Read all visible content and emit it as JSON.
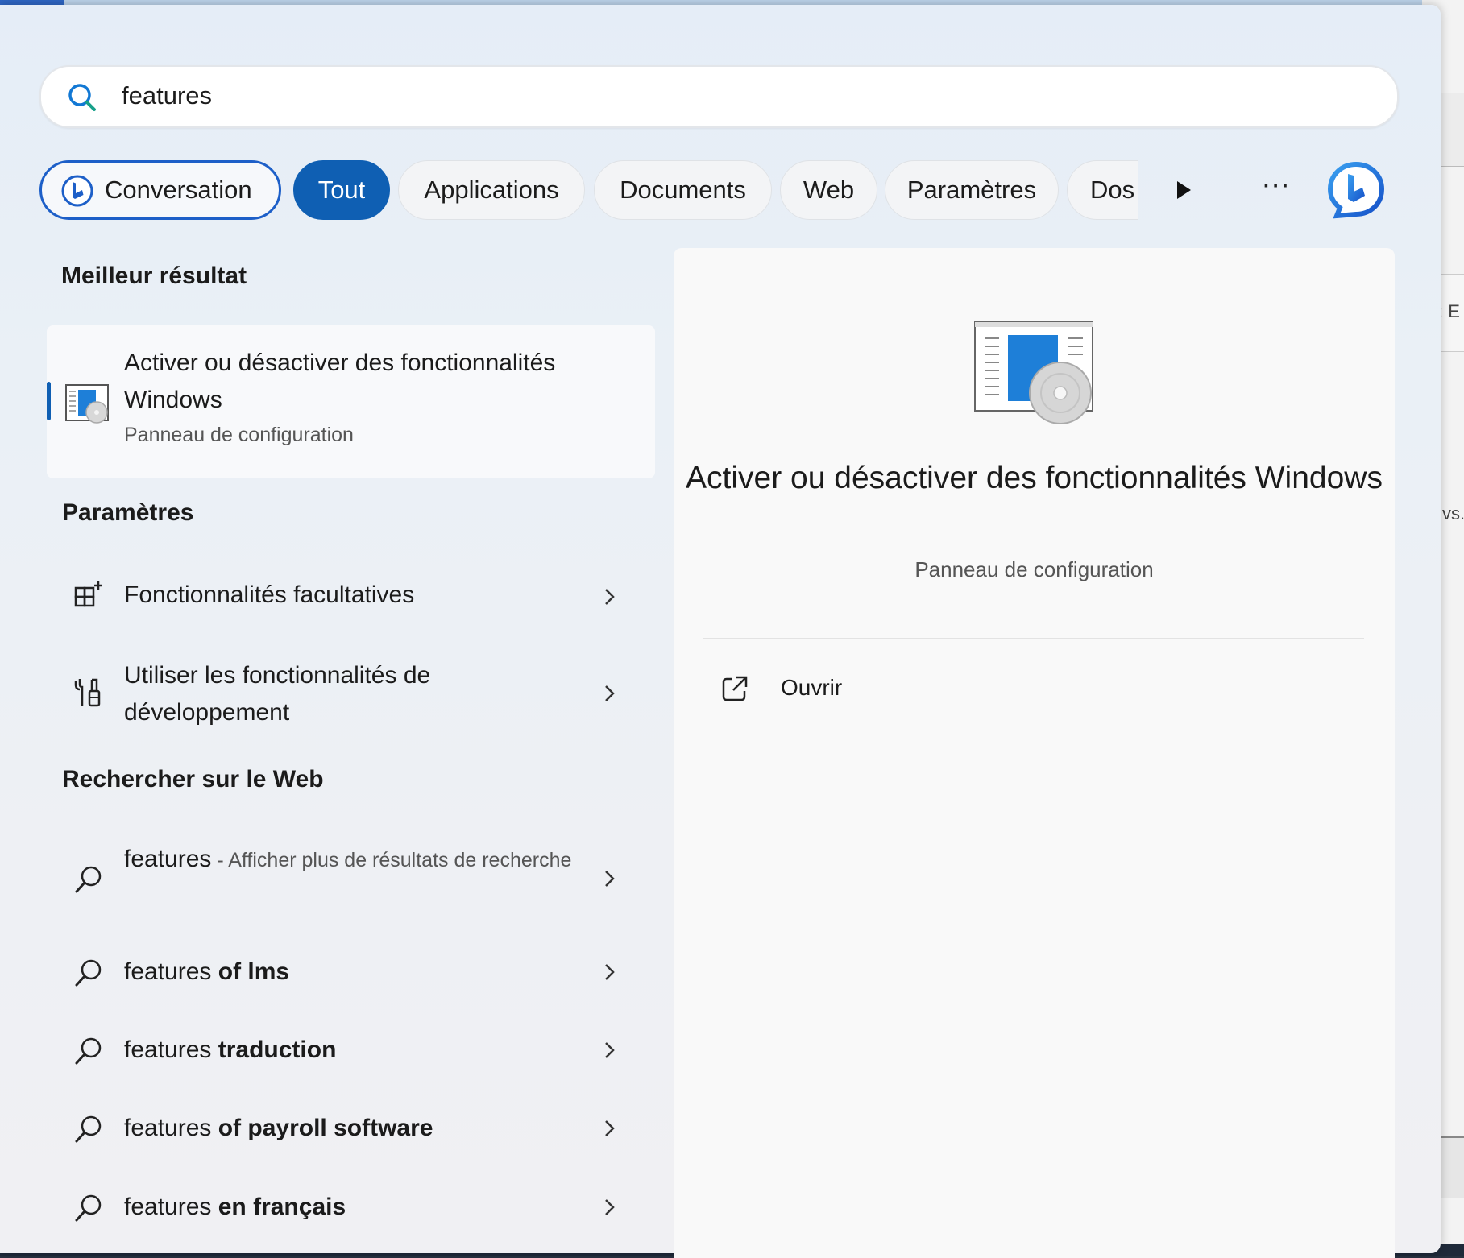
{
  "search": {
    "query": "features"
  },
  "filters": {
    "conversation": "Conversation",
    "all": "Tout",
    "apps": "Applications",
    "documents": "Documents",
    "web": "Web",
    "settings": "Paramètres",
    "folders": "Dos",
    "more": "···"
  },
  "best_match": {
    "heading": "Meilleur résultat",
    "title": "Activer ou désactiver des fonctionnalités Windows",
    "subtitle": "Panneau de configuration",
    "icon": "windows-features-icon"
  },
  "settings_section": {
    "heading": "Paramètres",
    "items": [
      {
        "label": "Fonctionnalités facultatives",
        "icon": "optional-features-icon"
      },
      {
        "label": "Utiliser les fonctionnalités de développement",
        "icon": "developer-tools-icon"
      }
    ]
  },
  "web_section": {
    "heading": "Rechercher sur le Web",
    "items": [
      {
        "prefix": "features",
        "suffix": " - Afficher plus de résultats de recherche"
      },
      {
        "prefix": "features",
        "suffix": " of lms"
      },
      {
        "prefix": "features",
        "suffix": " traduction"
      },
      {
        "prefix": "features",
        "suffix": " of payroll software"
      },
      {
        "prefix": "features",
        "suffix": " en français"
      }
    ]
  },
  "preview": {
    "title": "Activer ou désactiver des fonctionnalités Windows",
    "subtitle": "Panneau de configuration",
    "action_open": "Ouvrir"
  },
  "background": {
    "fragment1": ": E",
    "fragment2": "vs."
  },
  "colors": {
    "accent": "#0f5fb3",
    "bing_blue": "#1d5fc8",
    "panel_bg": "#eaf0f6"
  }
}
